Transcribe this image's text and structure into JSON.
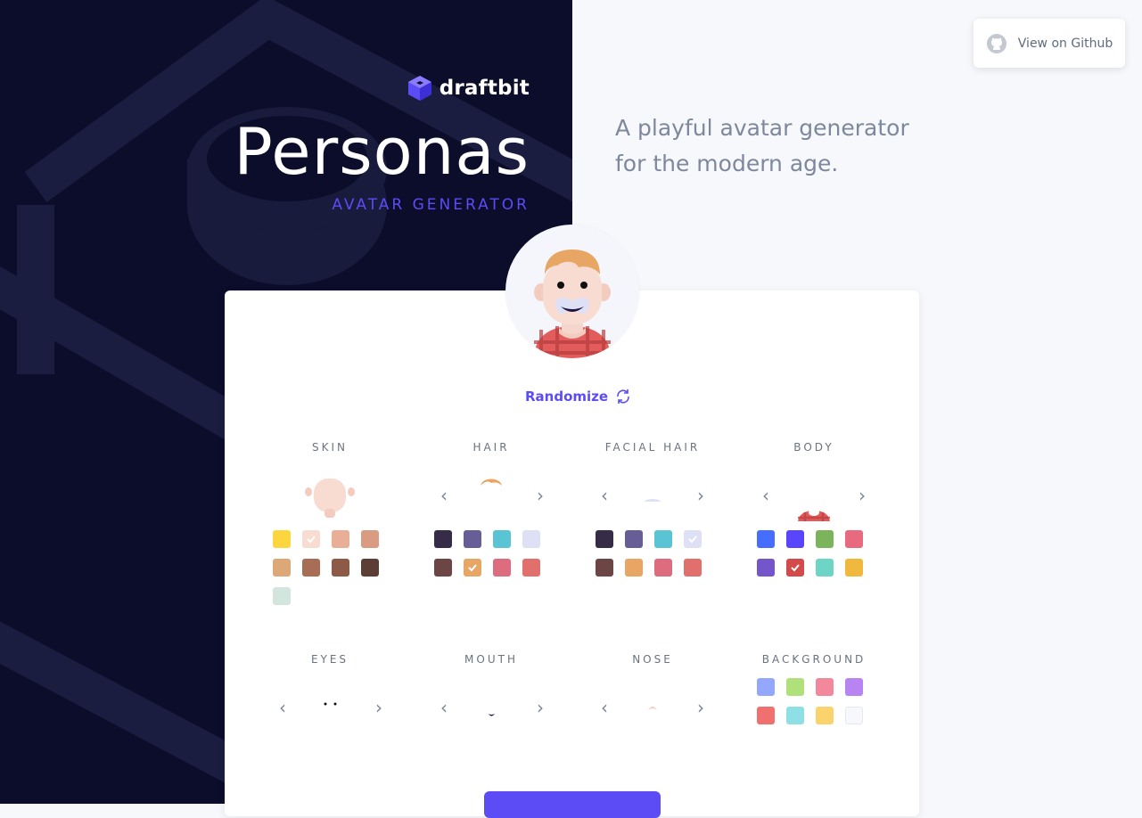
{
  "brand": {
    "name": "draftbit",
    "accent": "#5b4cf5"
  },
  "hero": {
    "title": "Personas",
    "subtitle": "AVATAR GENERATOR",
    "tagline": "A playful avatar generator for the modern age."
  },
  "header": {
    "github_label": "View on Github"
  },
  "randomize_label": "Randomize",
  "sections": {
    "skin": {
      "label": "SKIN",
      "swatches": [
        "#fcd53f",
        "#f8dcd2",
        "#e8ae96",
        "#d99b82",
        "#dda878",
        "#a86e55",
        "#8e5a48",
        "#5c3e34",
        "#d2e6de"
      ],
      "selected": 1
    },
    "hair": {
      "label": "HAIR",
      "swatches": [
        "#362c47",
        "#675e97",
        "#5ac4d4",
        "#dee1f5",
        "#6c4545",
        "#e8a664",
        "#dd6d7e",
        "#e16f6b"
      ],
      "selected": 5
    },
    "facial_hair": {
      "label": "FACIAL HAIR",
      "swatches": [
        "#362c47",
        "#675e97",
        "#5ac4d4",
        "#dee1f5",
        "#6c4545",
        "#e8a664",
        "#dd6d7e",
        "#e16f6b"
      ],
      "selected": 3
    },
    "body": {
      "label": "BODY",
      "swatches": [
        "#456dff",
        "#5a45ff",
        "#7cb45c",
        "#e86a7e",
        "#7555ca",
        "#d34a4a",
        "#6dd4c6",
        "#f0b83d"
      ],
      "selected": 5
    },
    "eyes": {
      "label": "EYES"
    },
    "mouth": {
      "label": "MOUTH"
    },
    "nose": {
      "label": "NOSE"
    },
    "background": {
      "label": "BACKGROUND",
      "swatches": [
        "#93a7ff",
        "#b0e07a",
        "#f3879c",
        "#b784f2",
        "#f07070",
        "#8fe0e4",
        "#fbd36c",
        "#f7f8fb"
      ]
    }
  }
}
